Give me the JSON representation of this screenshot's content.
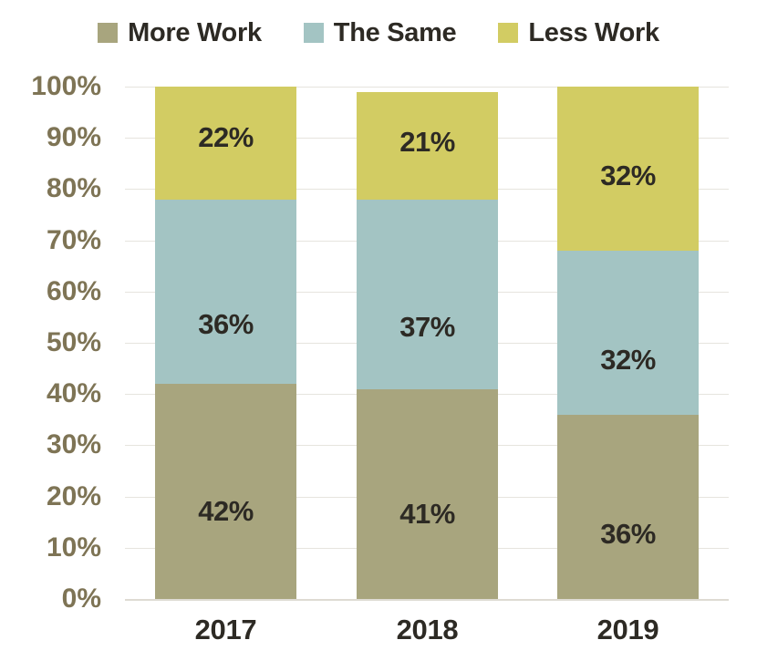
{
  "chart_data": {
    "type": "bar",
    "subtype": "100% stacked column",
    "title": "",
    "subtitle": "",
    "xlabel": "",
    "ylabel": "",
    "categories": [
      "2017",
      "2018",
      "2019"
    ],
    "series": [
      {
        "name": "More Work",
        "color": "#A8A57E",
        "values": [
          42,
          41,
          36
        ],
        "labels": [
          "42%",
          "41%",
          "36%"
        ]
      },
      {
        "name": "The Same",
        "color": "#A3C4C3",
        "values": [
          36,
          37,
          32
        ],
        "labels": [
          "36%",
          "37%",
          "32%"
        ]
      },
      {
        "name": "Less Work",
        "color": "#D2CC63",
        "values": [
          22,
          21,
          32
        ],
        "labels": [
          "22%",
          "21%",
          "32%"
        ]
      }
    ],
    "totals": [
      100,
      99,
      100
    ],
    "ylim": [
      0,
      100
    ],
    "y_tick_labels": [
      "100%",
      "90%",
      "80%",
      "70%",
      "60%",
      "50%",
      "40%",
      "30%",
      "20%",
      "10%",
      "0%"
    ],
    "y_tick_values": [
      100,
      90,
      80,
      70,
      60,
      50,
      40,
      30,
      20,
      10,
      0
    ],
    "grid": true,
    "legend_position": "top"
  },
  "legend": {
    "items": [
      {
        "label": "More Work",
        "color": "#A8A57E",
        "swatch_name": "legend-swatch-more-work"
      },
      {
        "label": "The Same",
        "color": "#A3C4C3",
        "swatch_name": "legend-swatch-the-same"
      },
      {
        "label": "Less Work",
        "color": "#D2CC63",
        "swatch_name": "legend-swatch-less-work"
      }
    ]
  },
  "colors": {
    "more_work": "#A8A57E",
    "the_same": "#A3C4C3",
    "less_work": "#D2CC63",
    "y_axis_text": "#7E7455",
    "x_axis_text": "#2D2A24",
    "data_label_text": "#2D2A24",
    "gridline": "#E6E4DE",
    "background": "#FFFFFF"
  }
}
